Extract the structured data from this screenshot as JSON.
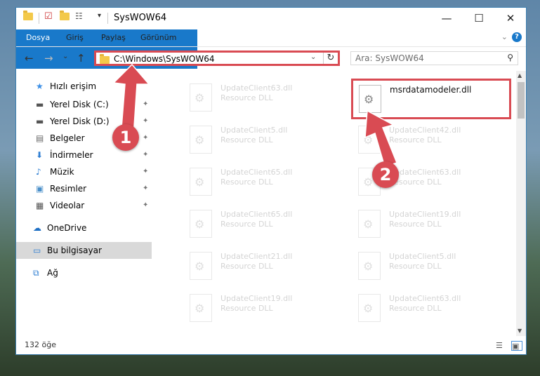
{
  "window": {
    "title": "SysWOW64",
    "minimize": "—",
    "maximize": "☐",
    "close": "✕"
  },
  "ribbon": {
    "tabs": [
      "Dosya",
      "Giriş",
      "Paylaş",
      "Görünüm"
    ],
    "help": "?",
    "collapse": "⌄"
  },
  "nav": {
    "back": "←",
    "forward": "→",
    "recent": "⌄",
    "up": "↑",
    "address": "C:\\Windows\\SysWOW64",
    "address_dropdown": "⌄",
    "refresh": "↻",
    "search_placeholder": "Ara: SysWOW64",
    "search_icon": "⚲"
  },
  "sidebar": {
    "items": [
      {
        "label": "Hızlı erişim",
        "icon": "star-icon",
        "glyph": "★",
        "color": "#3a8ee6",
        "pinned": false
      },
      {
        "label": "Yerel Disk (C:)",
        "icon": "drive-icon",
        "glyph": "▬",
        "color": "#555555",
        "pinned": true
      },
      {
        "label": "Yerel Disk (D:)",
        "icon": "drive-icon",
        "glyph": "▬",
        "color": "#555555",
        "pinned": true
      },
      {
        "label": "Belgeler",
        "icon": "documents-icon",
        "glyph": "▤",
        "color": "#6b6b6b",
        "pinned": true
      },
      {
        "label": "İndirmeler",
        "icon": "download-icon",
        "glyph": "⬇",
        "color": "#2d7dd2",
        "pinned": true
      },
      {
        "label": "Müzik",
        "icon": "music-icon",
        "glyph": "♪",
        "color": "#2d7dd2",
        "pinned": true
      },
      {
        "label": "Resimler",
        "icon": "pictures-icon",
        "glyph": "▣",
        "color": "#4a8fc9",
        "pinned": true
      },
      {
        "label": "Videolar",
        "icon": "videos-icon",
        "glyph": "▦",
        "color": "#555555",
        "pinned": true
      },
      {
        "label": "OneDrive",
        "icon": "cloud-icon",
        "glyph": "☁",
        "color": "#1e6fc4",
        "pinned": false
      },
      {
        "label": "Bu bilgisayar",
        "icon": "computer-icon",
        "glyph": "▭",
        "color": "#2d7dd2",
        "pinned": false
      },
      {
        "label": "Ağ",
        "icon": "network-icon",
        "glyph": "⧉",
        "color": "#2d7dd2",
        "pinned": false
      }
    ],
    "pin_glyph": "✦"
  },
  "files": {
    "left_column": [
      {
        "name": "UpdateClient63.dll",
        "type": "Resource DLL"
      },
      {
        "name": "UpdateClient5.dll",
        "type": "Resource DLL"
      },
      {
        "name": "UpdateClient65.dll",
        "type": "Resource DLL"
      },
      {
        "name": "UpdateClient65.dll",
        "type": "Resource DLL"
      },
      {
        "name": "UpdateClient21.dll",
        "type": "Resource DLL"
      },
      {
        "name": "UpdateClient19.dll",
        "type": "Resource DLL"
      }
    ],
    "right_column": [
      {
        "name": "msrdatamodeler.dll",
        "type": ""
      },
      {
        "name": "UpdateClient42.dll",
        "type": "Resource DLL"
      },
      {
        "name": "UpdateClient63.dll",
        "type": "Resource DLL"
      },
      {
        "name": "UpdateClient19.dll",
        "type": "Resource DLL"
      },
      {
        "name": "UpdateClient5.dll",
        "type": "Resource DLL"
      },
      {
        "name": "UpdateClient63.dll",
        "type": "Resource DLL"
      }
    ]
  },
  "status": {
    "count": "132 öğe"
  },
  "annotations": {
    "step1": "1",
    "step2": "2",
    "color": "#d94b53"
  }
}
